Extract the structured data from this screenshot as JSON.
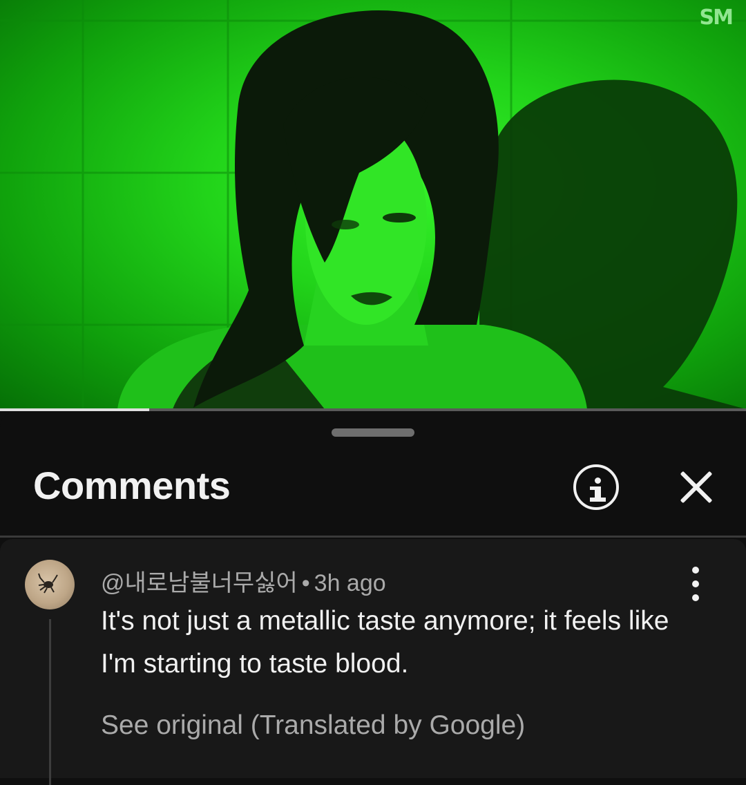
{
  "video": {
    "watermark": "SM",
    "progress": 0.2,
    "tint_color": "#22d41a"
  },
  "comments_panel": {
    "title": "Comments",
    "info_icon": "info-circle-icon",
    "close_icon": "close-icon"
  },
  "comment": {
    "author": "@내로남불너무싫어",
    "separator": "•",
    "time": "3h ago",
    "text": "It's not just a metallic taste anymore; it feels like I'm starting to taste blood.",
    "see_original": "See original (Translated by Google)",
    "more_icon": "more-vertical-icon"
  }
}
